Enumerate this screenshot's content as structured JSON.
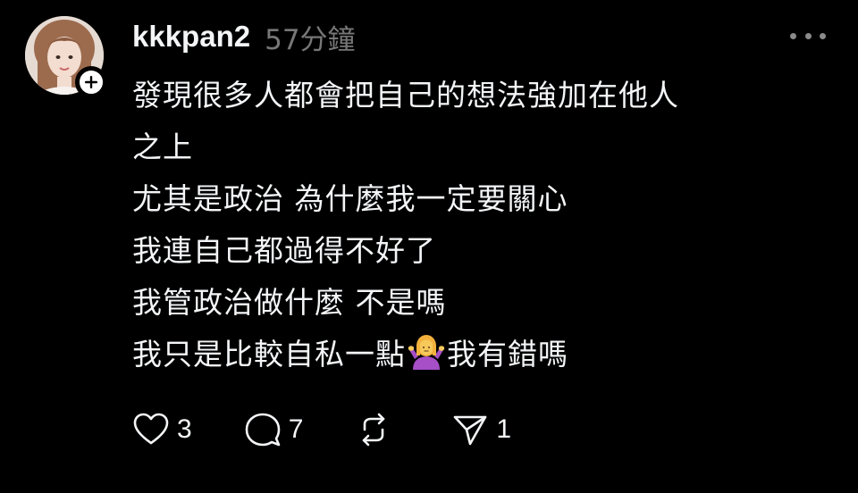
{
  "post": {
    "username": "kkkpan2",
    "timestamp": "57分鐘",
    "lines": [
      "發現很多人都會把自己的想法強加在他人",
      "之上",
      "尤其是政治 為什麼我一定要關心",
      "我連自己都過得不好了",
      "我管政治做什麼 不是嗎"
    ],
    "last_line_before_emoji": "我只是比較自私一點",
    "emoji": "person-shrugging-emoji",
    "last_line_after_emoji": "我有錯嗎",
    "actions": {
      "like_count": "3",
      "reply_count": "7",
      "repost_count": "",
      "share_count": "1"
    }
  },
  "icons": {
    "follow": "plus-icon",
    "more": "more-horizontal-icon",
    "like": "heart-icon",
    "reply": "comment-icon",
    "repost": "repost-icon",
    "share": "send-icon"
  },
  "colors": {
    "background": "#000000",
    "text": "#f3f5f7",
    "secondary_text": "#777777"
  }
}
